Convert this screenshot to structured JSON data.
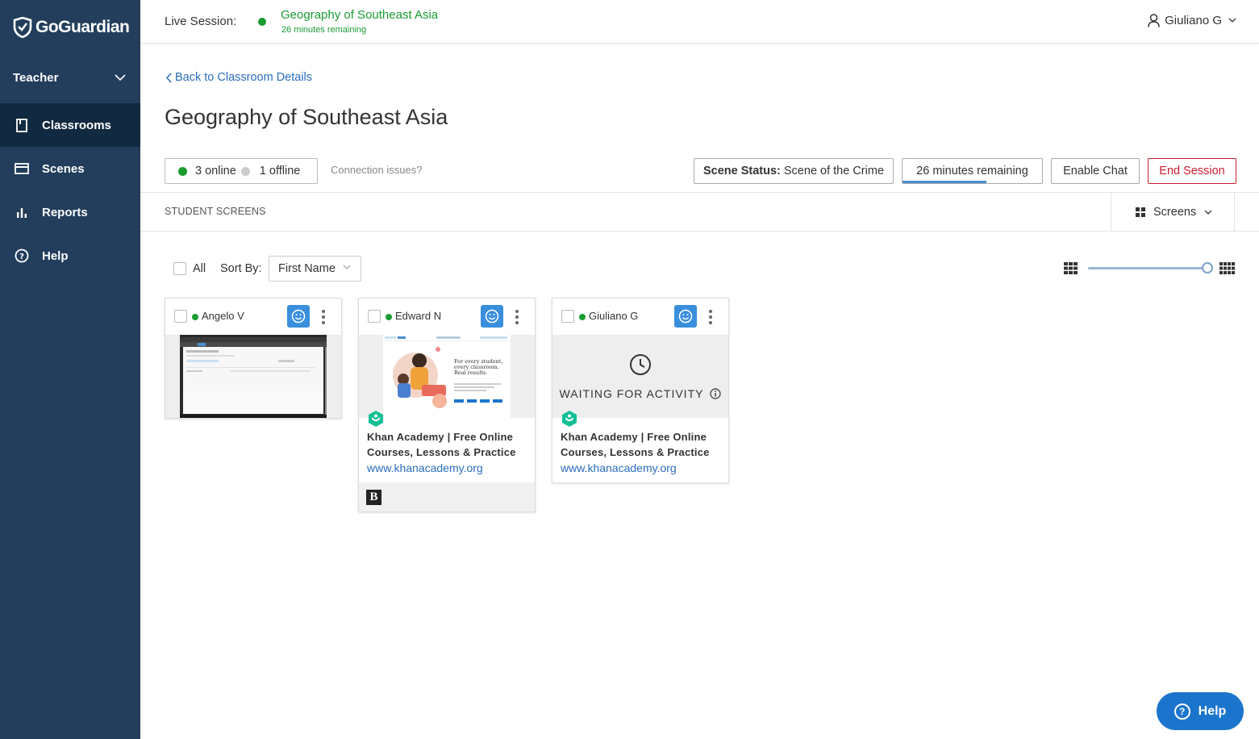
{
  "app": {
    "brand": "GoGuardian"
  },
  "sidebar": {
    "role": "Teacher",
    "items": [
      {
        "label": "Classrooms",
        "icon": "book-icon"
      },
      {
        "label": "Scenes",
        "icon": "window-icon"
      },
      {
        "label": "Reports",
        "icon": "bar-chart-icon"
      },
      {
        "label": "Help",
        "icon": "question-circle-icon"
      }
    ]
  },
  "header": {
    "live_label": "Live Session:",
    "session_title": "Geography of Southeast Asia",
    "session_remaining": "26 minutes remaining",
    "user_name": "Giuliano G"
  },
  "main": {
    "back_link": "Back to Classroom Details",
    "title": "Geography of Southeast Asia",
    "online_text": "3 online",
    "offline_text": "1 offline",
    "connection_link": "Connection issues?",
    "scene_status_label": "Scene Status:",
    "scene_status_value": "Scene of the Crime",
    "timer_label": "26 minutes remaining",
    "timer_progress": 0.6,
    "enable_chat_label": "Enable Chat",
    "end_session_label": "End Session",
    "section_label": "STUDENT SCREENS",
    "view_dropdown": "Screens",
    "all_label": "All",
    "sort_label": "Sort By:",
    "sort_value": "First Name",
    "zoom_level": 1.0
  },
  "students": [
    {
      "name": "Angelo V",
      "status": "online",
      "view": "screen"
    },
    {
      "name": "Edward N",
      "status": "online",
      "view": "site",
      "site_title": "Khan Academy | Free Online Courses, Lessons & Practice",
      "site_url": "www.khanacademy.org",
      "extra_tab_icon": "B"
    },
    {
      "name": "Giuliano G",
      "status": "online",
      "view": "waiting",
      "waiting_text": "WAITING FOR ACTIVITY",
      "site_title": "Khan Academy | Free Online Courses, Lessons & Practice",
      "site_url": "www.khanacademy.org"
    }
  ],
  "thumb_text": {
    "khan_headline_1": "For every student,",
    "khan_headline_2": "every classroom.",
    "khan_headline_3": "Real results."
  },
  "help_widget": {
    "label": "Help"
  },
  "colors": {
    "sidebar": "#233e5c",
    "online": "#1a9c32",
    "link": "#2a6ebb",
    "danger": "#c9202e",
    "help": "#1b75cc"
  }
}
